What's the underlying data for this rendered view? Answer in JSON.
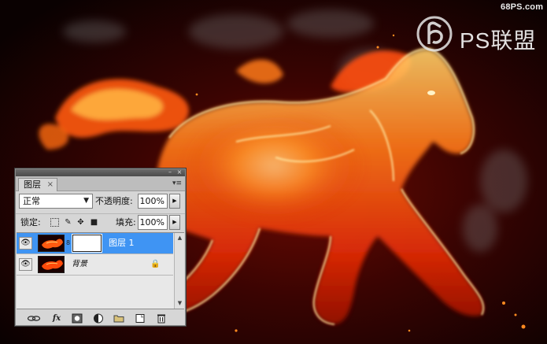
{
  "watermark": {
    "site": "68PS.com",
    "brand": "PS联盟"
  },
  "layers_panel": {
    "tab_label": "图层",
    "tab_close": "×",
    "blend_mode": "正常",
    "opacity_label": "不透明度:",
    "opacity_value": "100%",
    "lock_label": "锁定:",
    "fill_label": "填充:",
    "fill_value": "100%",
    "layers": [
      {
        "name": "图层 1",
        "selected": true,
        "visible": true,
        "has_mask": true
      },
      {
        "name": "背景",
        "selected": false,
        "visible": true,
        "locked": true
      }
    ],
    "footer_icons": [
      "link-layers-icon",
      "fx-icon",
      "add-mask-icon",
      "adjustment-layer-icon",
      "group-folder-icon",
      "new-layer-icon",
      "trash-icon"
    ],
    "fx_label": "fx"
  },
  "colors": {
    "selection": "#3f94f3",
    "panel_bg": "#d6d6d6",
    "flame_orange": "#ff7a1a",
    "background": "#0b0202"
  }
}
